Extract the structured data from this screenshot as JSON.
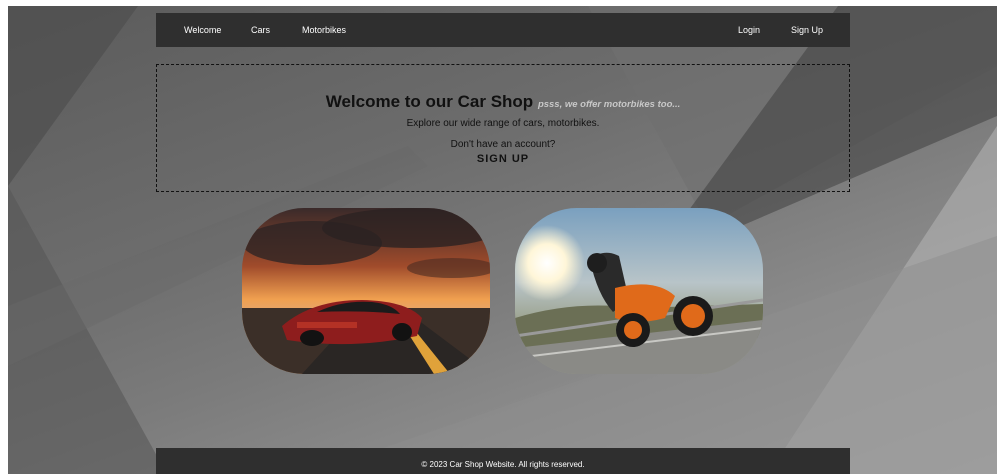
{
  "nav": {
    "left": [
      {
        "label": "Welcome"
      },
      {
        "label": "Cars"
      },
      {
        "label": "Motorbikes"
      }
    ],
    "right": [
      {
        "label": "Login"
      },
      {
        "label": "Sign Up"
      }
    ]
  },
  "hero": {
    "title": "Welcome to our Car Shop",
    "aside": "psss, we offer motorbikes too...",
    "subtitle": "Explore our wide range of cars, motorbikes.",
    "account_prompt": "Don't have an account?",
    "signup_label": "SIGN UP"
  },
  "cards": [
    {
      "image": "red-sports-car-on-road-at-sunset"
    },
    {
      "image": "orange-motorbike-leaning-into-turn"
    }
  ],
  "footer": {
    "text": "© 2023 Car Shop Website. All rights reserved."
  }
}
